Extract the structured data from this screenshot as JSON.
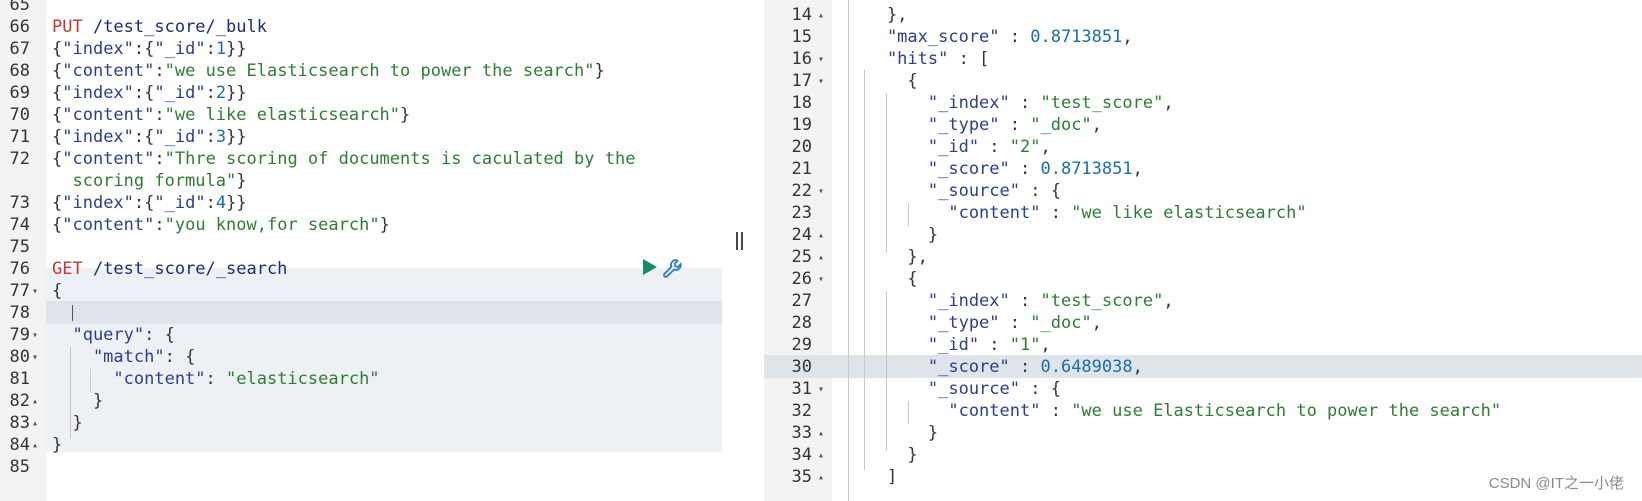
{
  "left_editor": {
    "lines": [
      {
        "num": "65",
        "fold": "",
        "segs": []
      },
      {
        "num": "66",
        "fold": "",
        "segs": [
          [
            "m",
            "PUT"
          ],
          [
            "u",
            " /test_score/_bulk"
          ]
        ]
      },
      {
        "num": "67",
        "fold": "",
        "segs": [
          [
            "p",
            "{"
          ],
          [
            "k",
            "\"index\""
          ],
          [
            "p",
            ":{"
          ],
          [
            "k",
            "\"_id\""
          ],
          [
            "p",
            ":"
          ],
          [
            "n",
            "1"
          ],
          [
            "p",
            "}}"
          ]
        ]
      },
      {
        "num": "68",
        "fold": "",
        "segs": [
          [
            "p",
            "{"
          ],
          [
            "k",
            "\"content\""
          ],
          [
            "p",
            ":"
          ],
          [
            "s",
            "\"we use Elasticsearch to power the search\""
          ],
          [
            "p",
            "}"
          ]
        ]
      },
      {
        "num": "69",
        "fold": "",
        "segs": [
          [
            "p",
            "{"
          ],
          [
            "k",
            "\"index\""
          ],
          [
            "p",
            ":{"
          ],
          [
            "k",
            "\"_id\""
          ],
          [
            "p",
            ":"
          ],
          [
            "n",
            "2"
          ],
          [
            "p",
            "}}"
          ]
        ]
      },
      {
        "num": "70",
        "fold": "",
        "segs": [
          [
            "p",
            "{"
          ],
          [
            "k",
            "\"content\""
          ],
          [
            "p",
            ":"
          ],
          [
            "s",
            "\"we like elasticsearch\""
          ],
          [
            "p",
            "}"
          ]
        ]
      },
      {
        "num": "71",
        "fold": "",
        "segs": [
          [
            "p",
            "{"
          ],
          [
            "k",
            "\"index\""
          ],
          [
            "p",
            ":{"
          ],
          [
            "k",
            "\"_id\""
          ],
          [
            "p",
            ":"
          ],
          [
            "n",
            "3"
          ],
          [
            "p",
            "}}"
          ]
        ]
      },
      {
        "num": "72",
        "fold": "",
        "segs": [
          [
            "p",
            "{"
          ],
          [
            "k",
            "\"content\""
          ],
          [
            "p",
            ":"
          ],
          [
            "s",
            "\"Thre scoring of documents is caculated by the"
          ]
        ]
      },
      {
        "num": "",
        "fold": "",
        "segs": [
          [
            "s",
            "  scoring formula\""
          ],
          [
            "p",
            "}"
          ]
        ]
      },
      {
        "num": "73",
        "fold": "",
        "segs": [
          [
            "p",
            "{"
          ],
          [
            "k",
            "\"index\""
          ],
          [
            "p",
            ":{"
          ],
          [
            "k",
            "\"_id\""
          ],
          [
            "p",
            ":"
          ],
          [
            "n",
            "4"
          ],
          [
            "p",
            "}}"
          ]
        ]
      },
      {
        "num": "74",
        "fold": "",
        "segs": [
          [
            "p",
            "{"
          ],
          [
            "k",
            "\"content\""
          ],
          [
            "p",
            ":"
          ],
          [
            "s",
            "\"you know,for search\""
          ],
          [
            "p",
            "}"
          ]
        ]
      },
      {
        "num": "75",
        "fold": "",
        "segs": []
      },
      {
        "num": "76",
        "fold": "",
        "segs": [
          [
            "m",
            "GET"
          ],
          [
            "u",
            " /test_score/_search"
          ]
        ]
      },
      {
        "num": "77",
        "fold": "▾",
        "segs": [
          [
            "p",
            "{"
          ]
        ]
      },
      {
        "num": "78",
        "fold": "",
        "segs": []
      },
      {
        "num": "79",
        "fold": "▾",
        "segs": [
          [
            "k",
            "  \"query\""
          ],
          [
            "p",
            ": {"
          ]
        ]
      },
      {
        "num": "80",
        "fold": "▾",
        "segs": [
          [
            "k",
            "    \"match\""
          ],
          [
            "p",
            ": {"
          ]
        ]
      },
      {
        "num": "81",
        "fold": "",
        "segs": [
          [
            "k",
            "      \"content\""
          ],
          [
            "p",
            ": "
          ],
          [
            "s",
            "\"elasticsearch\""
          ]
        ]
      },
      {
        "num": "82",
        "fold": "▴",
        "segs": [
          [
            "p",
            "    }"
          ]
        ]
      },
      {
        "num": "83",
        "fold": "▴",
        "segs": [
          [
            "p",
            "  }"
          ]
        ]
      },
      {
        "num": "84",
        "fold": "▴",
        "segs": [
          [
            "p",
            "}"
          ]
        ]
      },
      {
        "num": "85",
        "fold": "",
        "segs": []
      }
    ]
  },
  "right_editor": {
    "lines": [
      {
        "num": "14",
        "fold": "▴",
        "segs": [
          [
            "p",
            "    },"
          ]
        ]
      },
      {
        "num": "15",
        "fold": "",
        "segs": [
          [
            "k",
            "    \"max_score\""
          ],
          [
            "p",
            " : "
          ],
          [
            "n",
            "0.8713851"
          ],
          [
            "p",
            ","
          ]
        ]
      },
      {
        "num": "16",
        "fold": "▾",
        "segs": [
          [
            "k",
            "    \"hits\""
          ],
          [
            "p",
            " : ["
          ]
        ]
      },
      {
        "num": "17",
        "fold": "▾",
        "segs": [
          [
            "p",
            "      {"
          ]
        ]
      },
      {
        "num": "18",
        "fold": "",
        "segs": [
          [
            "k",
            "        \"_index\""
          ],
          [
            "p",
            " : "
          ],
          [
            "s",
            "\"test_score\""
          ],
          [
            "p",
            ","
          ]
        ]
      },
      {
        "num": "19",
        "fold": "",
        "segs": [
          [
            "k",
            "        \"_type\""
          ],
          [
            "p",
            " : "
          ],
          [
            "s",
            "\"_doc\""
          ],
          [
            "p",
            ","
          ]
        ]
      },
      {
        "num": "20",
        "fold": "",
        "segs": [
          [
            "k",
            "        \"_id\""
          ],
          [
            "p",
            " : "
          ],
          [
            "s",
            "\"2\""
          ],
          [
            "p",
            ","
          ]
        ]
      },
      {
        "num": "21",
        "fold": "",
        "segs": [
          [
            "k",
            "        \"_score\""
          ],
          [
            "p",
            " : "
          ],
          [
            "n",
            "0.8713851"
          ],
          [
            "p",
            ","
          ]
        ]
      },
      {
        "num": "22",
        "fold": "▾",
        "segs": [
          [
            "k",
            "        \"_source\""
          ],
          [
            "p",
            " : {"
          ]
        ]
      },
      {
        "num": "23",
        "fold": "",
        "segs": [
          [
            "k",
            "          \"content\""
          ],
          [
            "p",
            " : "
          ],
          [
            "s",
            "\"we like elasticsearch\""
          ]
        ]
      },
      {
        "num": "24",
        "fold": "▴",
        "segs": [
          [
            "p",
            "        }"
          ]
        ]
      },
      {
        "num": "25",
        "fold": "▴",
        "segs": [
          [
            "p",
            "      },"
          ]
        ]
      },
      {
        "num": "26",
        "fold": "▾",
        "segs": [
          [
            "p",
            "      {"
          ]
        ]
      },
      {
        "num": "27",
        "fold": "",
        "segs": [
          [
            "k",
            "        \"_index\""
          ],
          [
            "p",
            " : "
          ],
          [
            "s",
            "\"test_score\""
          ],
          [
            "p",
            ","
          ]
        ]
      },
      {
        "num": "28",
        "fold": "",
        "segs": [
          [
            "k",
            "        \"_type\""
          ],
          [
            "p",
            " : "
          ],
          [
            "s",
            "\"_doc\""
          ],
          [
            "p",
            ","
          ]
        ]
      },
      {
        "num": "29",
        "fold": "",
        "segs": [
          [
            "k",
            "        \"_id\""
          ],
          [
            "p",
            " : "
          ],
          [
            "s",
            "\"1\""
          ],
          [
            "p",
            ","
          ]
        ]
      },
      {
        "num": "30",
        "fold": "",
        "segs": [
          [
            "k",
            "        \"_score\""
          ],
          [
            "p",
            " : "
          ],
          [
            "n",
            "0.6489038"
          ],
          [
            "p",
            ","
          ]
        ]
      },
      {
        "num": "31",
        "fold": "▾",
        "segs": [
          [
            "k",
            "        \"_source\""
          ],
          [
            "p",
            " : {"
          ]
        ]
      },
      {
        "num": "32",
        "fold": "",
        "segs": [
          [
            "k",
            "          \"content\""
          ],
          [
            "p",
            " : "
          ],
          [
            "s",
            "\"we use Elasticsearch to power the search\""
          ]
        ]
      },
      {
        "num": "33",
        "fold": "▴",
        "segs": [
          [
            "p",
            "        }"
          ]
        ]
      },
      {
        "num": "34",
        "fold": "▴",
        "segs": [
          [
            "p",
            "      }"
          ]
        ]
      },
      {
        "num": "35",
        "fold": "▴",
        "segs": [
          [
            "p",
            "    ]"
          ]
        ]
      }
    ]
  },
  "watermark": "CSDN @IT之一小佬",
  "colors": {
    "method": "#c0392b",
    "url": "#1f2a7a",
    "key": "#2c3e8c",
    "string": "#2e7d32",
    "number": "#1a6ea8",
    "run_button": "#1b8a6b",
    "wrench_button": "#2a7fc9"
  },
  "icons": {
    "run": "play-icon",
    "settings": "wrench-icon",
    "splitter": "drag-handle-icon"
  }
}
